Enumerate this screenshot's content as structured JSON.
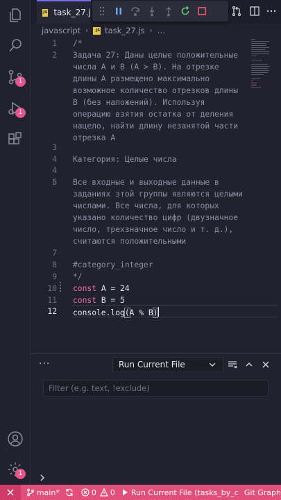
{
  "tab": {
    "icon": "JS",
    "label": "task_27.j"
  },
  "breadcrumb": {
    "folder": "javascript",
    "sep": "›",
    "file": "task_27.js",
    "rest": "…"
  },
  "activity": {
    "scm_badge": "1",
    "debug_badge": "1",
    "settings_badge": "1"
  },
  "editor": {
    "line_numbers": [
      "1",
      "2",
      "3",
      "4",
      "5",
      "6",
      "7",
      "8",
      "9",
      "10",
      "11",
      "12"
    ],
    "lines": [
      "/*",
      "Задача 27: Даны целые положительные",
      "числа A и B (A > B). На отрезке",
      "длины A размещено максимально",
      "возможное количество отрезков длины",
      "B (без наложений). Используя",
      "операцию взятия остатка от деления",
      "нацело, найти длину незанятой части",
      "отрезка A",
      "Категория: Целые числа",
      "Все входные и выходные данные в",
      "заданиях этой группы являются целыми",
      "числами. Все числа, для которых",
      "указано количество цифр (двузначное",
      "число, трехзначное число и т. д.),",
      "считаются положительными",
      "#category_integer",
      "*/"
    ],
    "code": {
      "kw": "const",
      "line10_rest": " A = 24",
      "line11_rest": " B = 5",
      "line12_fn": "console.log",
      "line12_open": "(",
      "line12_args": "A % B",
      "line12_close": ")"
    }
  },
  "panel": {
    "more": "···",
    "run_select": "Run Current File",
    "filter_placeholder": "Filter (e.g. text, !exclude)",
    "prompt": "›"
  },
  "statusbar": {
    "branch": "main*",
    "errors": "0",
    "warnings": "0",
    "run": "Run Current File (tasks_by_c",
    "git_graph": "Git Graph"
  },
  "colors": {
    "accent": "#e24f7a",
    "keyword": "#f06ea9",
    "comment": "#8e8ea8",
    "background": "#22222e"
  }
}
